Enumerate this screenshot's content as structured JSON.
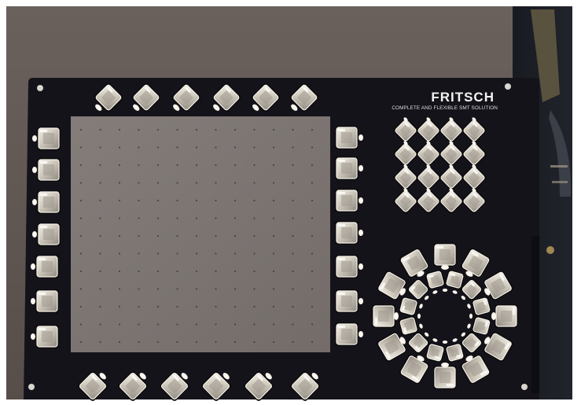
{
  "image": {
    "subject": "Fritsch SMT feeder/tray plate with arrays of square transparent pockets",
    "brand": "FRITSCH",
    "tagline": "COMPLETE AND FLEXIBLE SMT SOLUTION"
  },
  "colors": {
    "background_frame": "#ffffff",
    "workbench": "#5e5552",
    "plate": "#15131a",
    "center_pad": "#7d7775",
    "pocket_fill": "#c9c3b6",
    "pocket_highlight": "#f3efe6",
    "led_white": "#fbf7ee",
    "led_amber": "#f4d27a",
    "right_dark": "#1a1d24"
  },
  "layout_counts": {
    "top_row_pockets": 6,
    "bottom_row_pockets": 6,
    "left_column_pockets": 7,
    "right_column_pockets": 7,
    "upper_right_grid": "4 x 4",
    "circle_outer_ring": 12,
    "circle_inner_ring": 12
  }
}
